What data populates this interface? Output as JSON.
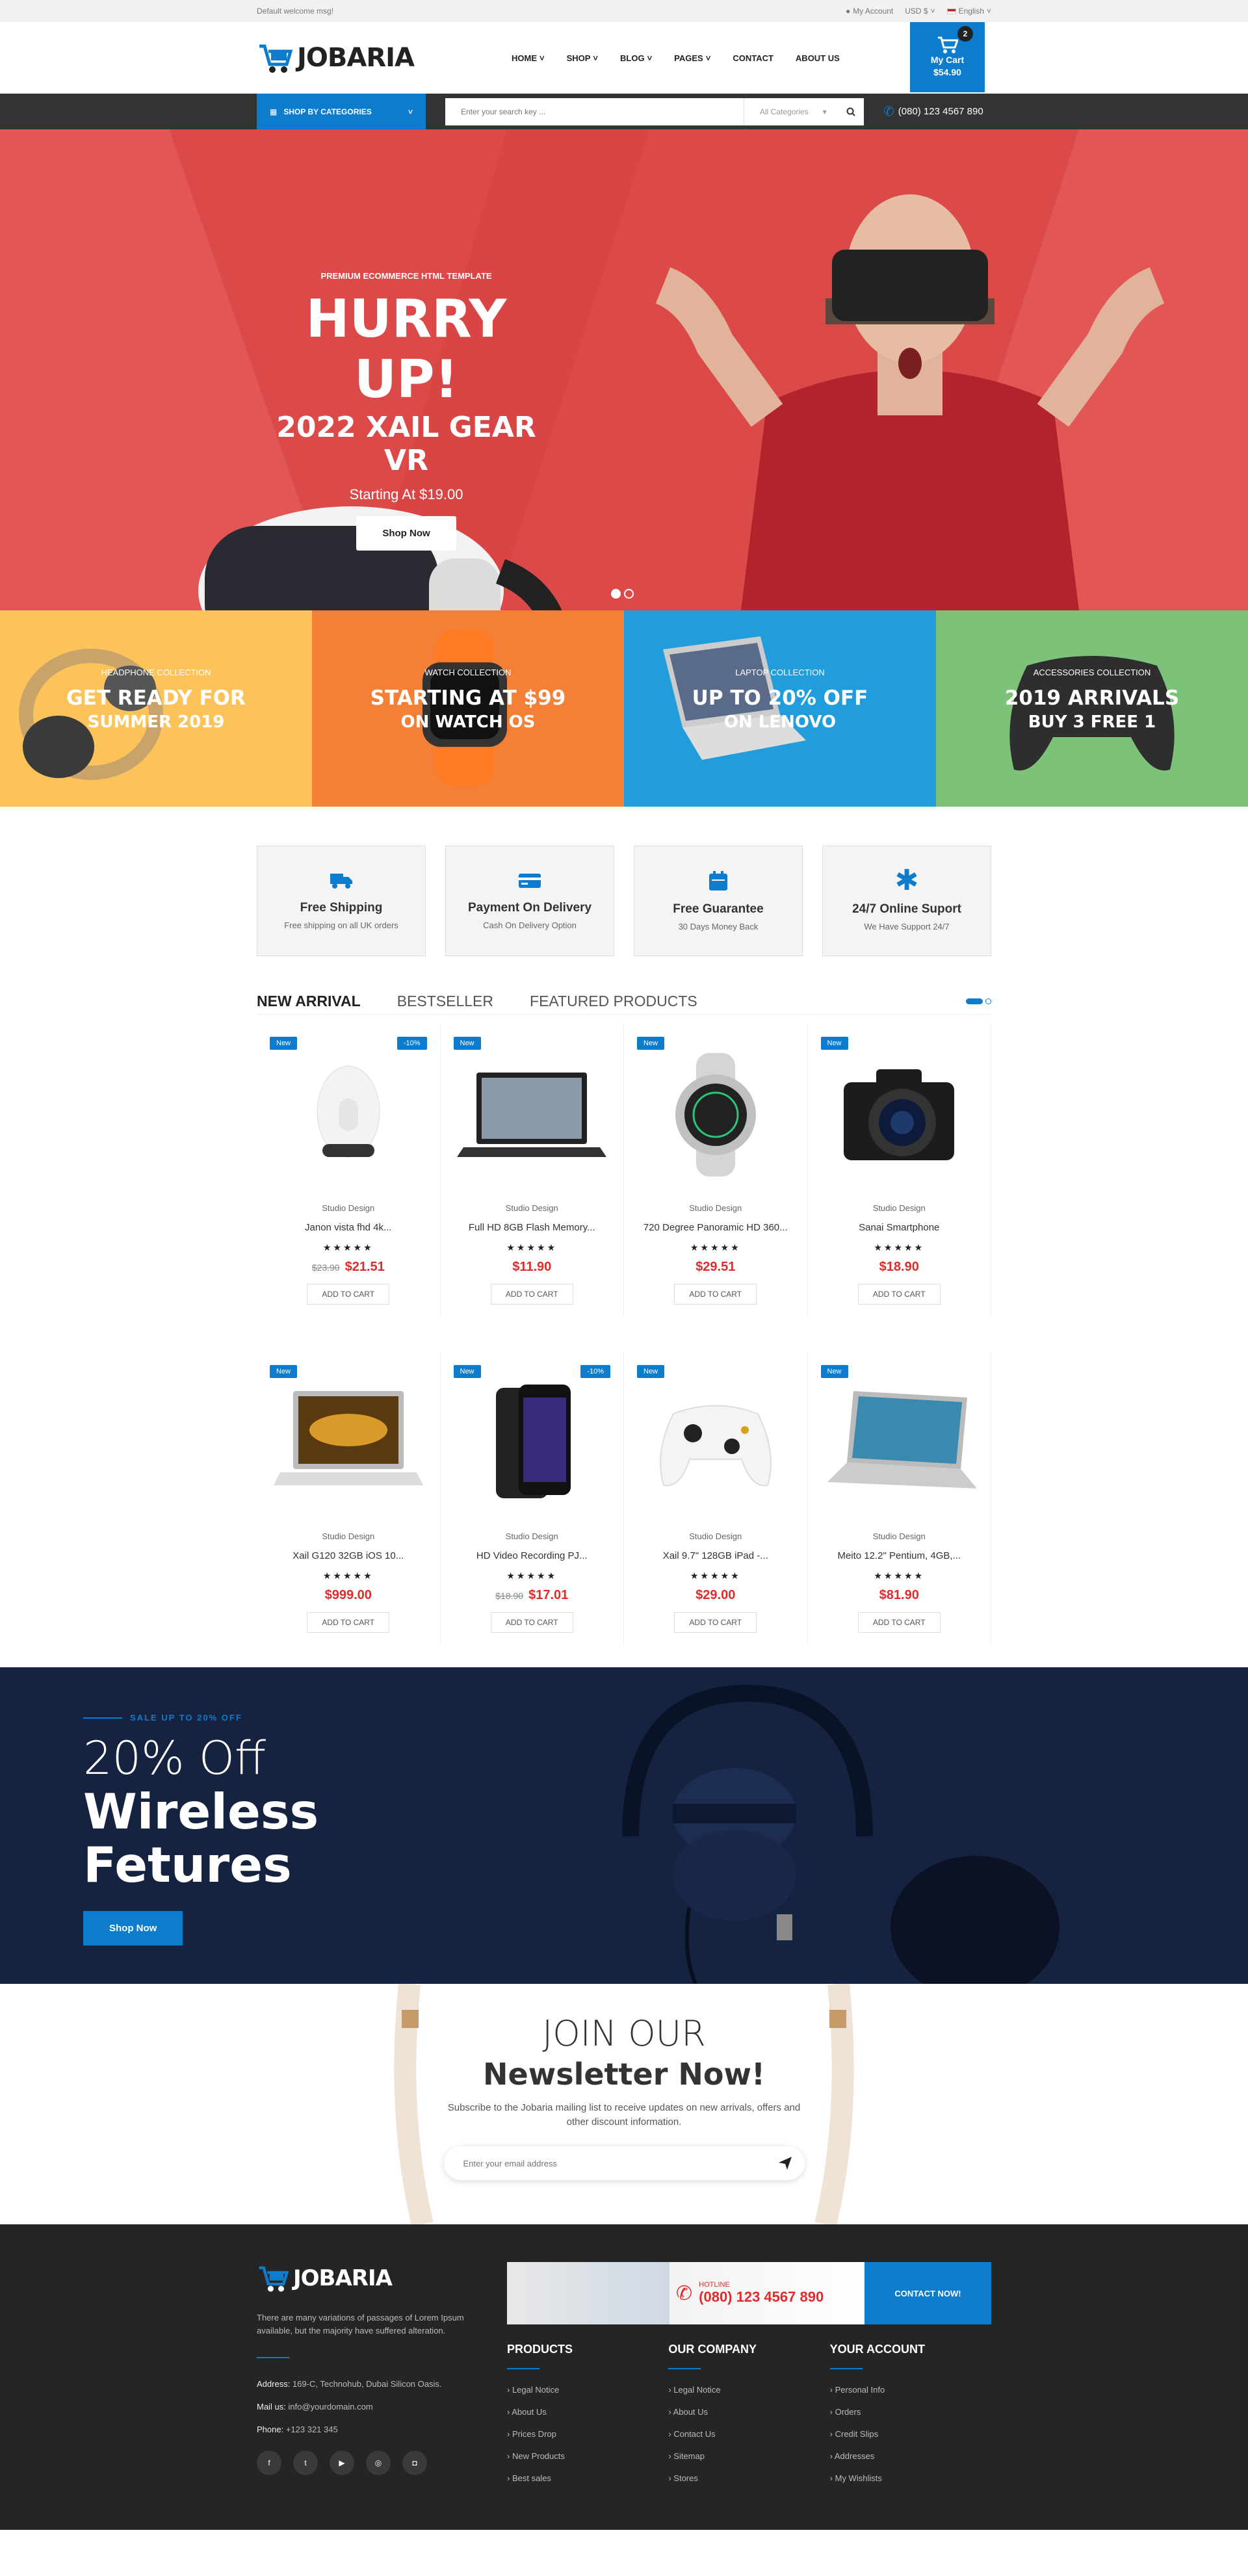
{
  "topbar": {
    "welcome": "Default welcome msg!",
    "account": "My Account",
    "currency": "USD $",
    "language": "English"
  },
  "header": {
    "logo": "JOBARIA",
    "nav": [
      "HOME",
      "SHOP",
      "BLOG",
      "PAGES",
      "CONTACT",
      "ABOUT US"
    ],
    "cart_label": "My Cart",
    "cart_total": "$54.90",
    "cart_count": "2"
  },
  "searchbar": {
    "categories_btn": "SHOP BY CATEGORIES",
    "placeholder": "Enter your search key ...",
    "category_select": "All Categories",
    "phone": "(080) 123 4567 890"
  },
  "hero": {
    "kicker": "PREMIUM ECOMMERCE HTML TEMPLATE",
    "title": "HURRY UP!",
    "subtitle": "2022 XAIL GEAR VR",
    "price": "Starting At $19.00",
    "button": "Shop Now"
  },
  "promos": [
    {
      "kicker": "HEADPHONE COLLECTION",
      "title": "GET READY FOR",
      "sub": "SUMMER 2019",
      "color": "#fcc35a"
    },
    {
      "kicker": "WATCH COLLECTION",
      "title": "STARTING AT $99",
      "sub": "ON WATCH OS",
      "color": "#f47f36"
    },
    {
      "kicker": "LAPTOP COLLECTION",
      "title": "UP TO 20% OFF",
      "sub": "ON LENOVO",
      "color": "#219ddc"
    },
    {
      "kicker": "ACCESSORIES COLLECTION",
      "title": "2019 ARRIVALS",
      "sub": "BUY 3 FREE 1",
      "color": "#7dc279"
    }
  ],
  "features": [
    {
      "title": "Free Shipping",
      "desc": "Free shipping on all UK orders",
      "icon": "truck-icon"
    },
    {
      "title": "Payment On Delivery",
      "desc": "Cash On Delivery Option",
      "icon": "credit-card-icon"
    },
    {
      "title": "Free Guarantee",
      "desc": "30 Days Money Back",
      "icon": "calendar-icon"
    },
    {
      "title": "24/7 Online Suport",
      "desc": "We Have Support 24/7",
      "icon": "asterisk-icon"
    }
  ],
  "product_tabs": [
    "NEW ARRIVAL",
    "BESTSELLER",
    "FEATURED PRODUCTS"
  ],
  "products": [
    {
      "badge": "New",
      "discount": "-10%",
      "brand": "Studio Design",
      "name": "Janon vista fhd 4k...",
      "old": "$23.90",
      "price": "$21.51",
      "cart": "ADD TO CART"
    },
    {
      "badge": "New",
      "discount": "",
      "brand": "Studio Design",
      "name": "Full HD 8GB Flash Memory...",
      "old": "",
      "price": "$11.90",
      "cart": "ADD TO CART"
    },
    {
      "badge": "New",
      "discount": "",
      "brand": "Studio Design",
      "name": "720 Degree Panoramic HD 360...",
      "old": "",
      "price": "$29.51",
      "cart": "ADD TO CART"
    },
    {
      "badge": "New",
      "discount": "",
      "brand": "Studio Design",
      "name": "Sanai Smartphone",
      "old": "",
      "price": "$18.90",
      "cart": "ADD TO CART"
    },
    {
      "badge": "New",
      "discount": "",
      "brand": "Studio Design",
      "name": "Xail G120 32GB iOS 10...",
      "old": "",
      "price": "$999.00",
      "cart": "ADD TO CART"
    },
    {
      "badge": "New",
      "discount": "-10%",
      "brand": "Studio Design",
      "name": "HD Video Recording PJ...",
      "old": "$18.90",
      "price": "$17.01",
      "cart": "ADD TO CART"
    },
    {
      "badge": "New",
      "discount": "",
      "brand": "Studio Design",
      "name": "Xail 9.7\" 128GB iPad -...",
      "old": "",
      "price": "$29.00",
      "cart": "ADD TO CART"
    },
    {
      "badge": "New",
      "discount": "",
      "brand": "Studio Design",
      "name": "Meito 12.2\" Pentium, 4GB,...",
      "old": "",
      "price": "$81.90",
      "cart": "ADD TO CART"
    }
  ],
  "sale": {
    "kicker": "SALE UP TO 20% OFF",
    "line1": "20% Off",
    "line2": "Wireless",
    "line3": "Fetures",
    "button": "Shop Now"
  },
  "newsletter": {
    "title1": "JOIN OUR",
    "title2": "Newsletter Now!",
    "desc": "Subscribe to the Jobaria mailing list to receive updates on new arrivals, offers and other discount information.",
    "placeholder": "Enter your email address"
  },
  "footer": {
    "logo": "JOBARIA",
    "desc": "There are many variations of passages of Lorem Ipsum available, but the majority have suffered alteration.",
    "address_label": "Address:",
    "address": "169-C, Technohub, Dubai Silicon Oasis.",
    "mail_label": "Mail us:",
    "mail": "info@yourdomain.com",
    "phone_label": "Phone:",
    "phone": "+123 321 345",
    "hotline_label": "HOTLINE",
    "hotline": "(080) 123 4567 890",
    "contact_btn": "CONTACT NOW!",
    "cols": [
      {
        "title": "PRODUCTS",
        "links": [
          "Legal Notice",
          "About Us",
          "Prices Drop",
          "New Products",
          "Best sales"
        ]
      },
      {
        "title": "OUR COMPANY",
        "links": [
          "Legal Notice",
          "About Us",
          "Contact Us",
          "Sitemap",
          "Stores"
        ]
      },
      {
        "title": "YOUR ACCOUNT",
        "links": [
          "Personal Info",
          "Orders",
          "Credit Slips",
          "Addresses",
          "My Wishlists"
        ]
      }
    ]
  }
}
